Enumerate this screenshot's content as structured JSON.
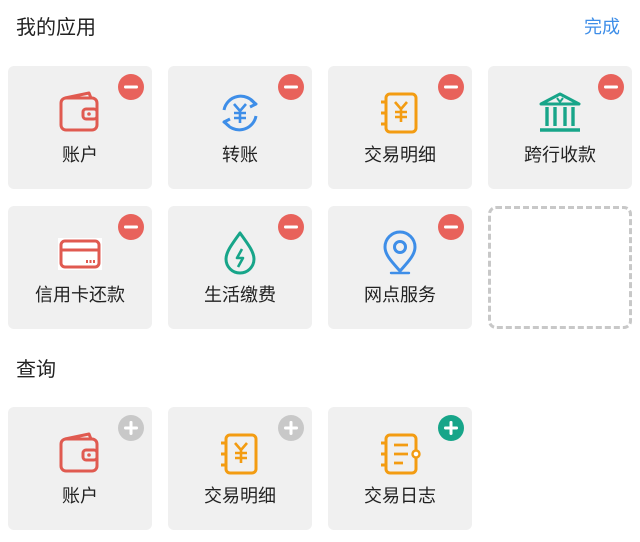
{
  "header": {
    "title": "我的应用",
    "done_label": "完成"
  },
  "my_apps": [
    {
      "label": "账户",
      "icon": "wallet-icon"
    },
    {
      "label": "转账",
      "icon": "transfer-icon"
    },
    {
      "label": "交易明细",
      "icon": "transaction-details-icon"
    },
    {
      "label": "跨行收款",
      "icon": "bank-icon"
    },
    {
      "label": "信用卡还款",
      "icon": "credit-card-icon"
    },
    {
      "label": "生活缴费",
      "icon": "water-drop-icon"
    },
    {
      "label": "网点服务",
      "icon": "location-pin-icon"
    }
  ],
  "query": {
    "title": "查询",
    "items": [
      {
        "label": "账户",
        "icon": "wallet-icon",
        "badge": "add-disabled"
      },
      {
        "label": "交易明细",
        "icon": "transaction-details-icon",
        "badge": "add-disabled"
      },
      {
        "label": "交易日志",
        "icon": "transaction-log-icon",
        "badge": "add"
      }
    ]
  },
  "colors": {
    "accent": "#3e8ee8",
    "remove_badge": "#e8625b",
    "add_badge": "#17a589",
    "disabled_badge": "#c8c8c8",
    "wallet": "#e05a50",
    "transfer": "#3e8ee8",
    "details": "#f39c12",
    "bank": "#17a589",
    "water": "#17a589",
    "location": "#3e8ee8"
  }
}
